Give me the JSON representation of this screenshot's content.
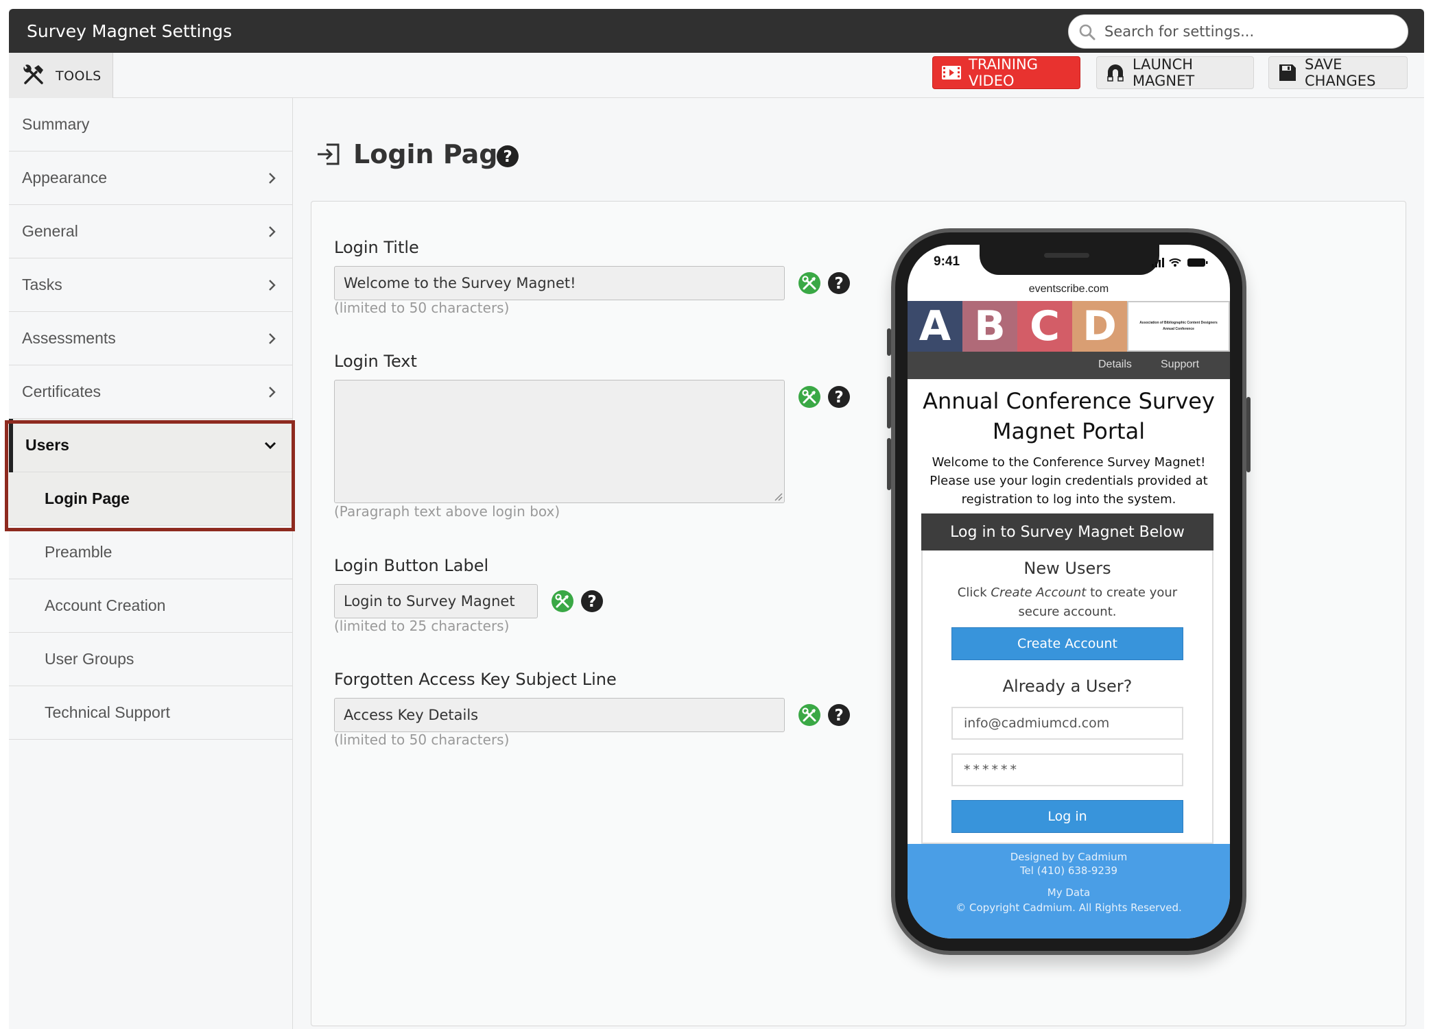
{
  "app": {
    "title": "Survey Magnet Settings"
  },
  "search": {
    "placeholder": "Search for settings..."
  },
  "toolbar": {
    "tools_label": "TOOLS",
    "training_label": "TRAINING VIDEO",
    "launch_label": "LAUNCH MAGNET",
    "save_label": "SAVE CHANGES"
  },
  "sidebar": {
    "items": [
      {
        "label": "Summary"
      },
      {
        "label": "Appearance"
      },
      {
        "label": "General"
      },
      {
        "label": "Tasks"
      },
      {
        "label": "Assessments"
      },
      {
        "label": "Certificates"
      },
      {
        "label": "Users"
      },
      {
        "label": "Login Page"
      },
      {
        "label": "Preamble"
      },
      {
        "label": "Account Creation"
      },
      {
        "label": "User Groups"
      },
      {
        "label": "Technical Support"
      }
    ]
  },
  "page": {
    "title": "Login Page"
  },
  "form": {
    "login_title": {
      "label": "Login Title",
      "value": "Welcome to the Survey Magnet!",
      "hint": "(limited to 50 characters)"
    },
    "login_text": {
      "label": "Login Text",
      "value": "",
      "hint": "(Paragraph text above login box)"
    },
    "login_button": {
      "label": "Login Button Label",
      "value": "Login to Survey Magnet",
      "hint": "(limited to 25 characters)"
    },
    "forgot_subject": {
      "label": "Forgotten Access Key Subject Line",
      "value": "Access Key Details",
      "hint": "(limited to 50 characters)"
    }
  },
  "preview": {
    "time": "9:41",
    "url": "eventscribe.com",
    "banner_letters": [
      "A",
      "B",
      "C",
      "D"
    ],
    "assoc_line1": "Association of Bibliographic Content Designers",
    "assoc_line2": "Annual Conference",
    "nav_details": "Details",
    "nav_support": "Support",
    "portal_title": "Annual Conference Survey Magnet Portal",
    "portal_text": "Welcome to the Conference Survey Magnet! Please use your login credentials provided at registration to log into the system.",
    "box_header": "Log in to Survey Magnet Below",
    "new_users_heading": "New Users",
    "new_users_text_before": "Click ",
    "new_users_text_em": "Create Account",
    "new_users_text_after": " to create your secure account.",
    "create_account_label": "Create Account",
    "already_user_heading": "Already a User?",
    "email_value": "info@cadmiumcd.com",
    "password_value": "******",
    "login_label": "Log in",
    "footer_line1": "Designed by Cadmium",
    "footer_line2": "Tel (410) 638-9239",
    "footer_line3": "My Data",
    "footer_line4": "© Copyright Cadmium. All Rights Reserved."
  },
  "colors": {
    "titlebar": "#303030",
    "training_red": "#e8322f",
    "accent_green": "#3aa845",
    "selection_border": "#8e2a1f",
    "preview_blue": "#3894db"
  }
}
